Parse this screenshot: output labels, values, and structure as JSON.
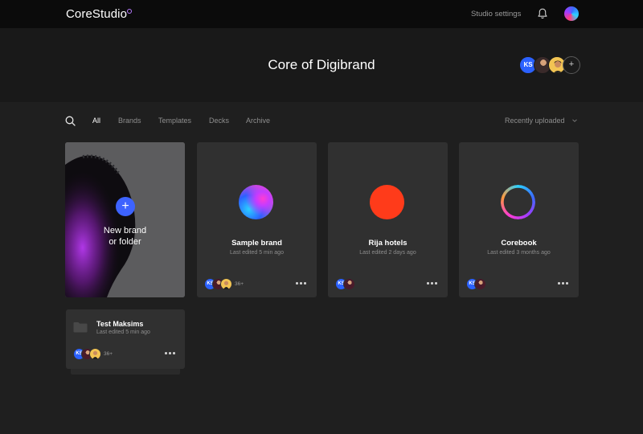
{
  "header": {
    "logo": "CoreStudio",
    "settings_label": "Studio settings",
    "icons": [
      "bell-icon",
      "profile-avatar"
    ]
  },
  "hero": {
    "title": "Core of Digibrand",
    "members": [
      "KS"
    ],
    "add_label": "+"
  },
  "filters": {
    "tabs": [
      "All",
      "Brands",
      "Templates",
      "Decks",
      "Archive"
    ],
    "active": "All",
    "sort_label": "Recently uploaded"
  },
  "new_card": {
    "label_line1": "New brand",
    "label_line2": "or folder",
    "plus": "+"
  },
  "brands": [
    {
      "name": "Sample brand",
      "edited": "Last edited 5 min ago",
      "count": "36+",
      "icon": "gradient-sphere"
    },
    {
      "name": "Rija hotels",
      "edited": "Last edited 2 days ago",
      "count": "",
      "icon": "red-circle"
    },
    {
      "name": "Corebook",
      "edited": "Last edited 3 months ago",
      "count": "",
      "icon": "gradient-ring"
    }
  ],
  "folder": {
    "name": "Test Maksims",
    "edited": "Last edited 5 min ago",
    "count": "36+"
  },
  "avatar_initials": "KS",
  "colors": {
    "accent": "#3d63ff",
    "avatar_blue": "#2b61ff",
    "rija_red": "#ff3b1a"
  }
}
